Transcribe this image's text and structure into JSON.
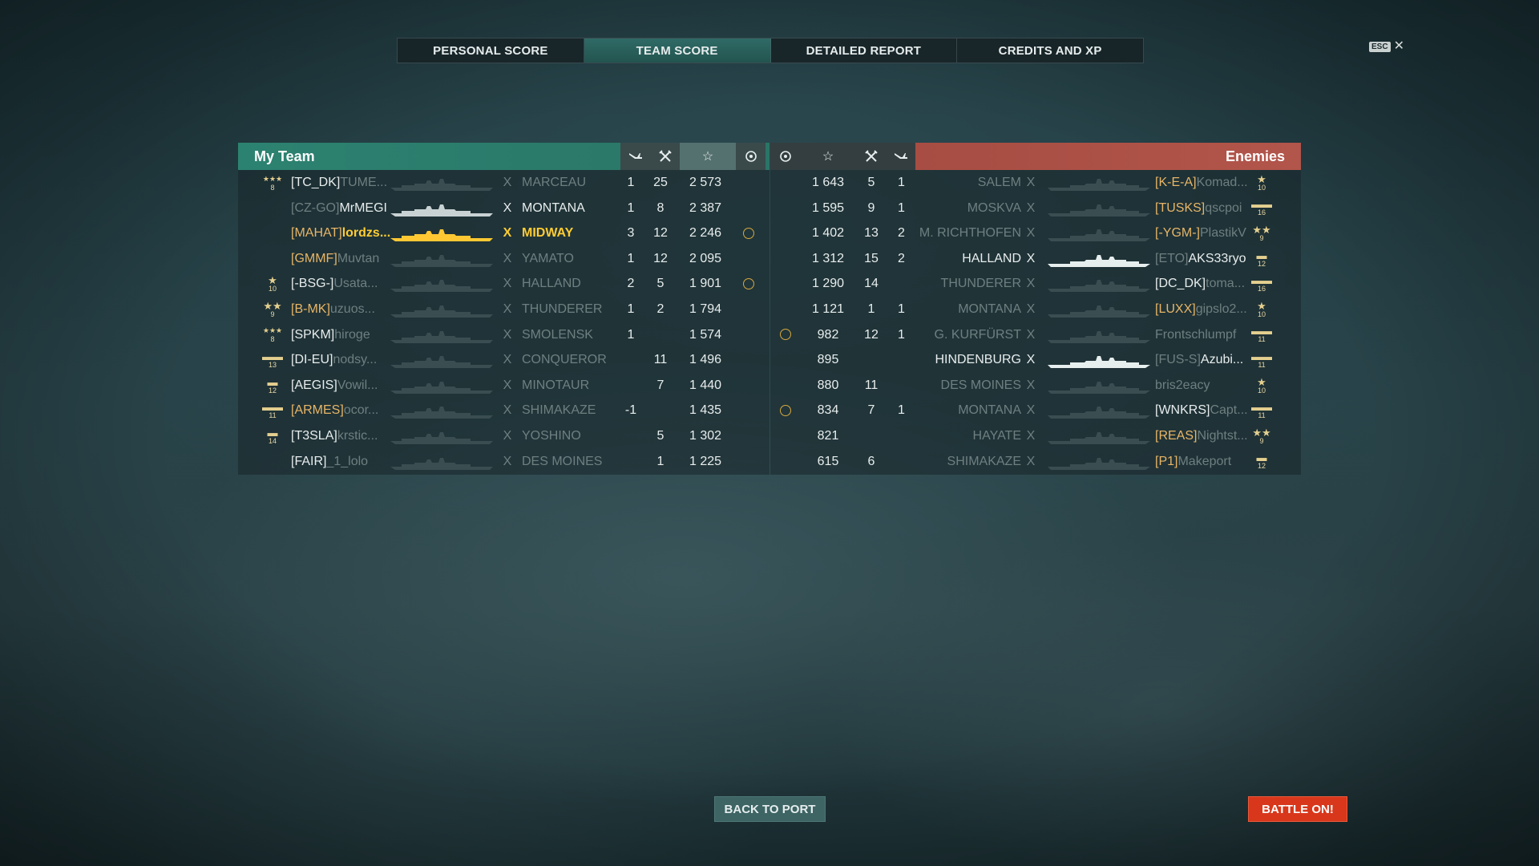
{
  "tabs": [
    "PERSONAL SCORE",
    "TEAM SCORE",
    "DETAILED REPORT",
    "CREDITS AND XP"
  ],
  "active_tab": 1,
  "esc": {
    "key": "ESC",
    "close": "✕"
  },
  "my_team": {
    "title": "My Team",
    "rows": [
      {
        "rank": "8",
        "rank_icon": "stars-3",
        "clan": "[TC_DK]",
        "name": "TUME...",
        "ship": "MARCEAU",
        "style": "dim",
        "c1": "1",
        "c2": "25",
        "c3": "2 573",
        "c4": ""
      },
      {
        "rank": "",
        "rank_icon": "",
        "clan": "[CZ-GO]",
        "name": "MrMEGI",
        "ship": "MONTANA",
        "style": "white",
        "c1": "1",
        "c2": "8",
        "c3": "2 387",
        "c4": ""
      },
      {
        "rank": "",
        "rank_icon": "",
        "clan": "[MAHAT]",
        "name": "lordzs...",
        "ship": "MIDWAY",
        "style": "self",
        "c1": "3",
        "c2": "12",
        "c3": "2 246",
        "c4": "emblem"
      },
      {
        "rank": "",
        "rank_icon": "",
        "clan": "[GMMF]",
        "name": "Muvtan",
        "ship": "YAMATO",
        "style": "gold-dim",
        "c1": "1",
        "c2": "12",
        "c3": "2 095",
        "c4": ""
      },
      {
        "rank": "10",
        "rank_icon": "star-1",
        "clan": "[-BSG-]",
        "name": "Usata...",
        "ship": "HALLAND",
        "style": "dim",
        "c1": "2",
        "c2": "5",
        "c3": "1 901",
        "c4": "emblem"
      },
      {
        "rank": "9",
        "rank_icon": "stars-2",
        "clan": "[B-MK]",
        "name": "uzuos...",
        "ship": "THUNDERER",
        "style": "gold-dim",
        "c1": "1",
        "c2": "2",
        "c3": "1 794",
        "c4": ""
      },
      {
        "rank": "8",
        "rank_icon": "stars-3",
        "clan": "[SPKM]",
        "name": "hiroge",
        "ship": "SMOLENSK",
        "style": "dim",
        "c1": "1",
        "c2": "",
        "c3": "1 574",
        "c4": ""
      },
      {
        "rank": "13",
        "rank_icon": "bars",
        "clan": "[DI-EU]",
        "name": "nodsy...",
        "ship": "CONQUEROR",
        "style": "dim",
        "c1": "",
        "c2": "11",
        "c3": "1 496",
        "c4": ""
      },
      {
        "rank": "12",
        "rank_icon": "bar",
        "clan": "[AEGIS]",
        "name": "Vowil...",
        "ship": "MINOTAUR",
        "style": "dim",
        "c1": "",
        "c2": "7",
        "c3": "1 440",
        "c4": ""
      },
      {
        "rank": "11",
        "rank_icon": "bars",
        "clan": "[ARMES]",
        "name": "ocor...",
        "ship": "SHIMAKAZE",
        "style": "gold-dim",
        "c1": "-1",
        "c2": "",
        "c3": "1 435",
        "c4": ""
      },
      {
        "rank": "14",
        "rank_icon": "bar",
        "clan": "[T3SLA]",
        "name": "krstic...",
        "ship": "YOSHINO",
        "style": "dim",
        "c1": "",
        "c2": "5",
        "c3": "1 302",
        "c4": ""
      },
      {
        "rank": "",
        "rank_icon": "",
        "clan": "[FAIR]",
        "name": "_1_lolo",
        "ship": "DES MOINES",
        "style": "dim",
        "c1": "",
        "c2": "1",
        "c3": "1 225",
        "c4": ""
      }
    ]
  },
  "enemies": {
    "title": "Enemies",
    "rows": [
      {
        "c4": "",
        "c3": "1 643",
        "c2": "5",
        "c1": "1",
        "ship": "SALEM",
        "clan": "[K-E-A]",
        "name": "Komad...",
        "style": "gold-dim",
        "rank": "10",
        "rank_icon": "star-1"
      },
      {
        "c4": "",
        "c3": "1 595",
        "c2": "9",
        "c1": "1",
        "ship": "MOSKVA",
        "clan": "[TUSKS]",
        "name": "qscpoi",
        "style": "gold-dim",
        "rank": "16",
        "rank_icon": "bars"
      },
      {
        "c4": "",
        "c3": "1 402",
        "c2": "13",
        "c1": "2",
        "ship": "M. RICHTHOFEN",
        "clan": "[-YGM-]",
        "name": "PlastikV",
        "style": "gold-dim",
        "rank": "9",
        "rank_icon": "stars-2"
      },
      {
        "c4": "",
        "c3": "1 312",
        "c2": "15",
        "c1": "2",
        "ship": "HALLAND",
        "clan": "[ETO]",
        "name": "AKS33ryo",
        "style": "bright",
        "rank": "12",
        "rank_icon": "bar"
      },
      {
        "c4": "",
        "c3": "1 290",
        "c2": "14",
        "c1": "",
        "ship": "THUNDERER",
        "clan": "[DC_DK]",
        "name": "toma...",
        "style": "dim",
        "rank": "16",
        "rank_icon": "bars"
      },
      {
        "c4": "",
        "c3": "1 121",
        "c2": "1",
        "c1": "1",
        "ship": "MONTANA",
        "clan": "[LUXX]",
        "name": "gipslo2...",
        "style": "gold-dim",
        "rank": "10",
        "rank_icon": "star-1"
      },
      {
        "c4": "emblem",
        "c3": "982",
        "c2": "12",
        "c1": "1",
        "ship": "G. KURFÜRST",
        "clan": "",
        "name": "Frontschlumpf",
        "style": "dim",
        "rank": "11",
        "rank_icon": "bars"
      },
      {
        "c4": "",
        "c3": "895",
        "c2": "",
        "c1": "",
        "ship": "HINDENBURG",
        "clan": "[FUS-S]",
        "name": "Azubi...",
        "style": "bright",
        "rank": "11",
        "rank_icon": "bars"
      },
      {
        "c4": "",
        "c3": "880",
        "c2": "11",
        "c1": "",
        "ship": "DES MOINES",
        "clan": "",
        "name": "bris2eacy",
        "style": "dim",
        "rank": "10",
        "rank_icon": "star-1"
      },
      {
        "c4": "emblem",
        "c3": "834",
        "c2": "7",
        "c1": "1",
        "ship": "MONTANA",
        "clan": "[WNKRS]",
        "name": "Capt...",
        "style": "dim",
        "rank": "11",
        "rank_icon": "bars"
      },
      {
        "c4": "",
        "c3": "821",
        "c2": "",
        "c1": "",
        "ship": "HAYATE",
        "clan": "[REAS]",
        "name": "Nightst...",
        "style": "gold-dim",
        "rank": "9",
        "rank_icon": "stars-2"
      },
      {
        "c4": "",
        "c3": "615",
        "c2": "6",
        "c1": "",
        "ship": "SHIMAKAZE",
        "clan": "[P1]",
        "name": "Makeport",
        "style": "gold-dim",
        "rank": "12",
        "rank_icon": "bar"
      }
    ]
  },
  "buttons": {
    "back_to_port": "BACK TO PORT",
    "battle_on": "BATTLE ON!"
  }
}
